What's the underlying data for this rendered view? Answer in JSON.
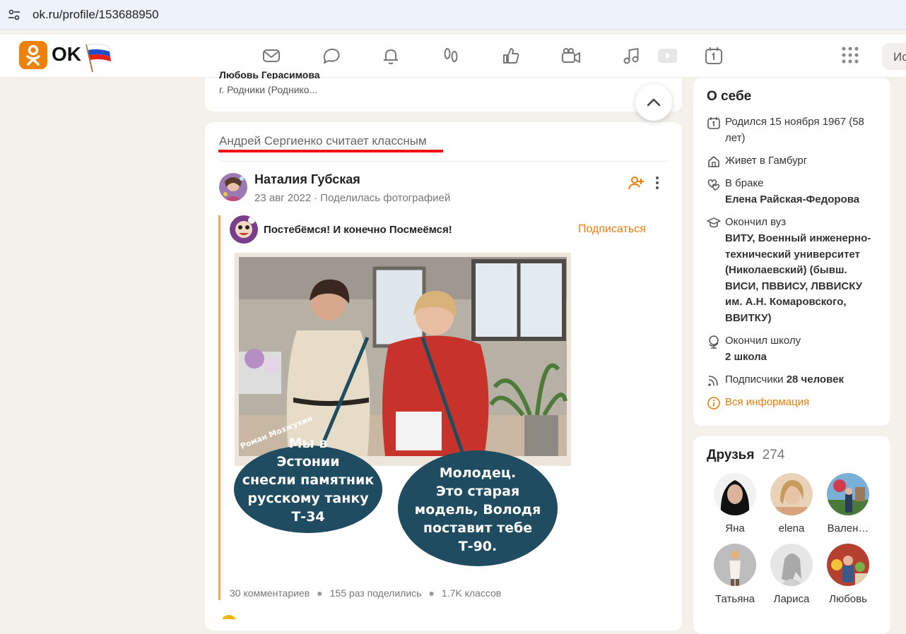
{
  "browser": {
    "url": "ok.ru/profile/153688950"
  },
  "brand": {
    "logo_text": "OK",
    "accent": "#ee8208"
  },
  "nav_icons": [
    "mail-icon",
    "chat-icon",
    "bell-icon",
    "guests-icon",
    "like-icon",
    "video-call-icon",
    "music-icon",
    "video-icon",
    "calendar-icon",
    "apps-grid-icon"
  ],
  "search": {
    "placeholder": "Ис"
  },
  "previous_card": {
    "name": "Любовь Герасимова",
    "city": "г. Родники (Роднико..."
  },
  "feed": {
    "liked_heading": "Андрей Сергиенко считает классным",
    "post": {
      "author": "Наталия Губская",
      "date": "23 авг 2022",
      "action": "Поделилась фотографией",
      "group_name": "Постебёмся! И конечно Посмеёмся!",
      "subscribe_label": "Подписаться",
      "photo": {
        "watermark": "Роман Мозжухин",
        "bubble_left": [
          "Мы в",
          "Эстонии",
          "снесли памятник",
          "русскому танку",
          "Т-34"
        ],
        "bubble_right": [
          "Молодец.",
          "Это старая",
          "модель, Володя",
          "поставит тебе",
          "Т-90."
        ]
      },
      "stats": {
        "comments": "30 комментариев",
        "shares": "155 раз поделились",
        "classes": "1.7K классов"
      }
    }
  },
  "about": {
    "title": "О себе",
    "born": "Родился 15 ноября 1967 (58 лет)",
    "lives": "Живет в Гамбург",
    "married_label": "В браке",
    "spouse": "Елена Райская-Федорова",
    "university_label": "Окончил вуз",
    "university": "ВИТУ, Военный инженерно-технический университет (Николаевский) (бывш. ВИСИ, ПВВИСУ, ЛВВИСКУ им. А.Н. Комаровского, ВВИТКУ)",
    "school_label": "Окончил школу",
    "school": "2 школа",
    "subscribers_label": "Подписчики",
    "subscribers_value": "28 человек",
    "all_info": "Вся информация"
  },
  "friends": {
    "title": "Друзья",
    "count": "274",
    "items": [
      {
        "name": "Яна"
      },
      {
        "name": "elena"
      },
      {
        "name": "Вален…"
      },
      {
        "name": "Татьяна"
      },
      {
        "name": "Лариса"
      },
      {
        "name": "Любовь"
      }
    ]
  }
}
